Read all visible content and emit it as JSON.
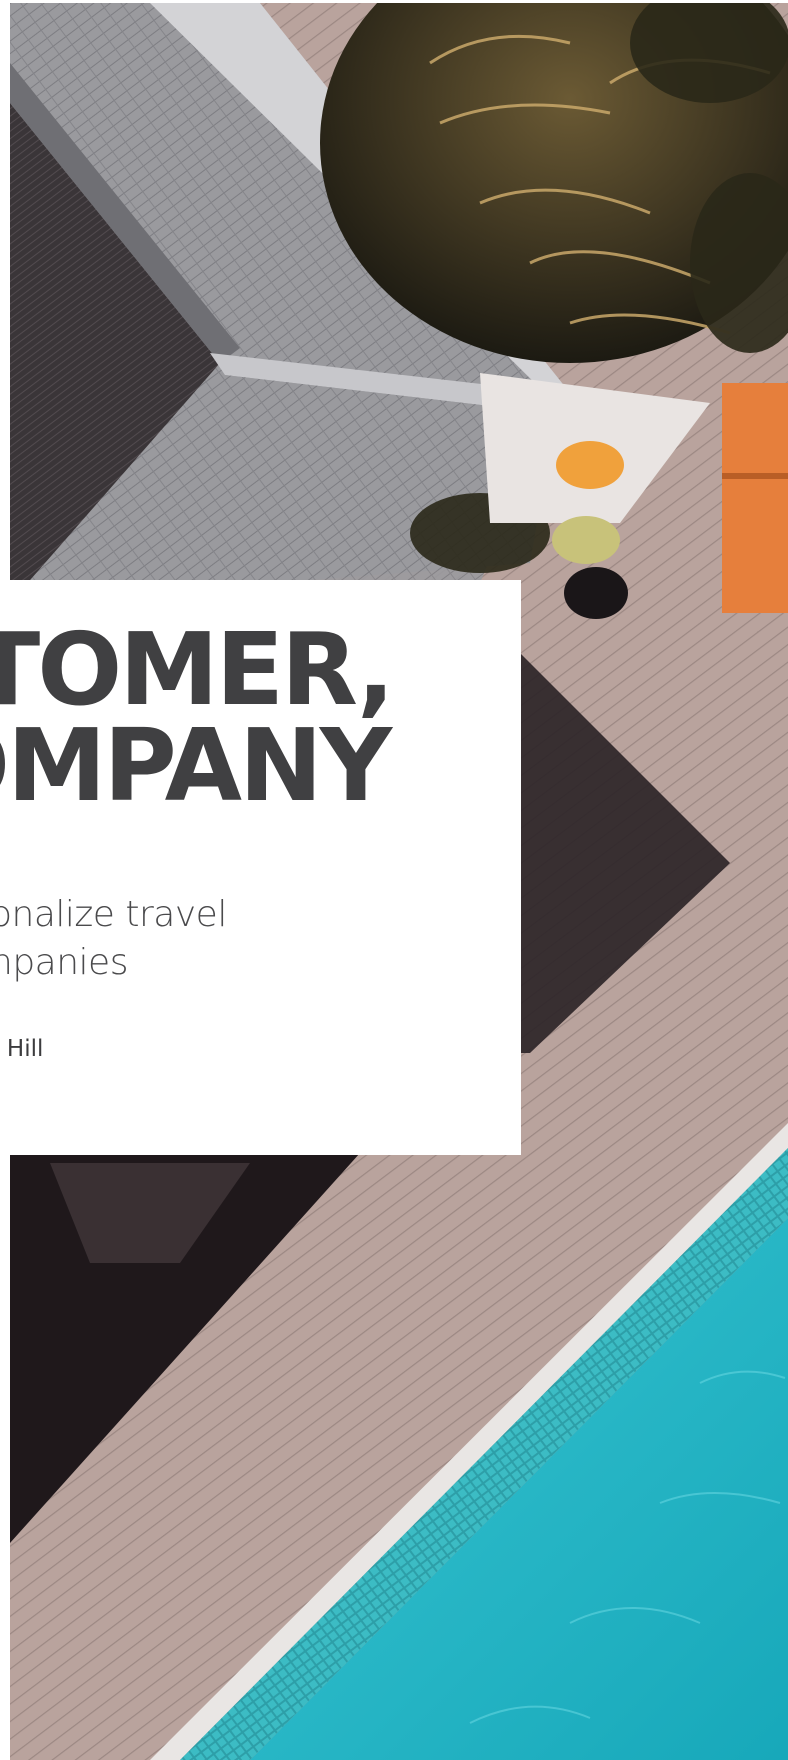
{
  "cover": {
    "title_line1": "TOMER,",
    "title_line2": "OMPANY",
    "subtitle_line1": "onalize travel",
    "subtitle_line2": "npanies",
    "author": "x Hill",
    "photo_icon": "aerial-resort-pool-photo"
  },
  "colors": {
    "title": "#404042",
    "subtitle": "#4a4a4c",
    "deck": "#b59f99",
    "roof": "#8c8c8f",
    "pool": "#1fb4c4",
    "lounger": "#e67f3c"
  }
}
